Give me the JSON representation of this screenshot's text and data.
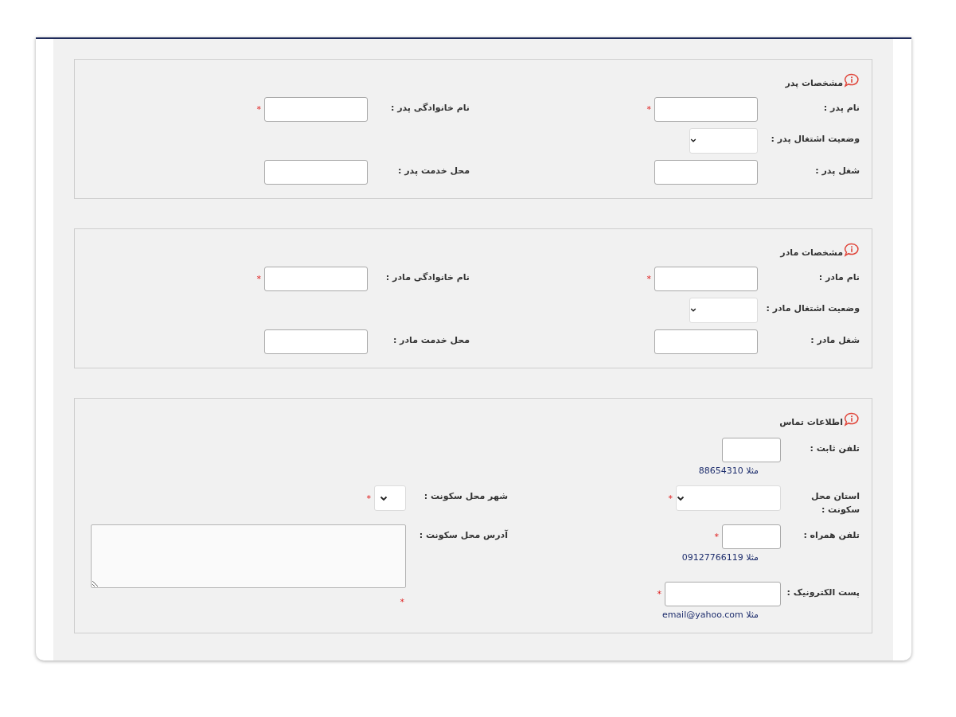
{
  "sections": [
    {
      "kind": "parent",
      "title": "مشخصات پدر",
      "rows": [
        {
          "fields": [
            {
              "label": "نام پدر :",
              "kind": "text",
              "mark": "*"
            },
            {
              "label": "نام خانوادگی پدر :",
              "kind": "text",
              "mark": "*"
            }
          ]
        },
        {
          "fields": [
            {
              "label": "وضعیت اشتغال پدر :",
              "kind": "select"
            }
          ]
        },
        {
          "fields": [
            {
              "label": "شغل پدر :",
              "kind": "text"
            },
            {
              "label": "محل خدمت پدر :",
              "kind": "text"
            }
          ]
        }
      ]
    },
    {
      "kind": "parent",
      "title": "مشخصات مادر",
      "rows": [
        {
          "fields": [
            {
              "label": "نام مادر :",
              "kind": "text",
              "mark": "*"
            },
            {
              "label": "نام خانوادگی مادر :",
              "kind": "text",
              "mark": "*"
            }
          ]
        },
        {
          "fields": [
            {
              "label": "وضعیت اشتغال مادر :",
              "kind": "select"
            }
          ]
        },
        {
          "fields": [
            {
              "label": "شغل مادر :",
              "kind": "text"
            },
            {
              "label": "محل خدمت مادر :",
              "kind": "text"
            }
          ]
        }
      ]
    },
    {
      "kind": "contact",
      "title": "اطلاعات تماس",
      "rows": [
        {
          "fields": [
            {
              "label": "تلفن ثابت :",
              "kind": "phone",
              "hint": "مثلا 88654310"
            }
          ]
        },
        {
          "fields": [
            {
              "label": "استان محل سکونت :",
              "kind": "wide_select",
              "mark": "*"
            },
            {
              "label": "شهر محل سکونت :",
              "kind": "small_select",
              "mark": "*"
            }
          ]
        },
        {
          "fields": [
            {
              "label": "تلفن همراه :",
              "kind": "phone",
              "mark": "*",
              "hint": "مثلا 09127766119"
            },
            {
              "label": "آدرس محل سکونت :",
              "kind": "textarea",
              "mark": "*"
            }
          ]
        },
        {
          "fields": [
            {
              "label": "پست الکترونیک :",
              "kind": "email",
              "mark": "*",
              "hint": "مثلا email@yahoo.com"
            }
          ]
        }
      ]
    }
  ]
}
